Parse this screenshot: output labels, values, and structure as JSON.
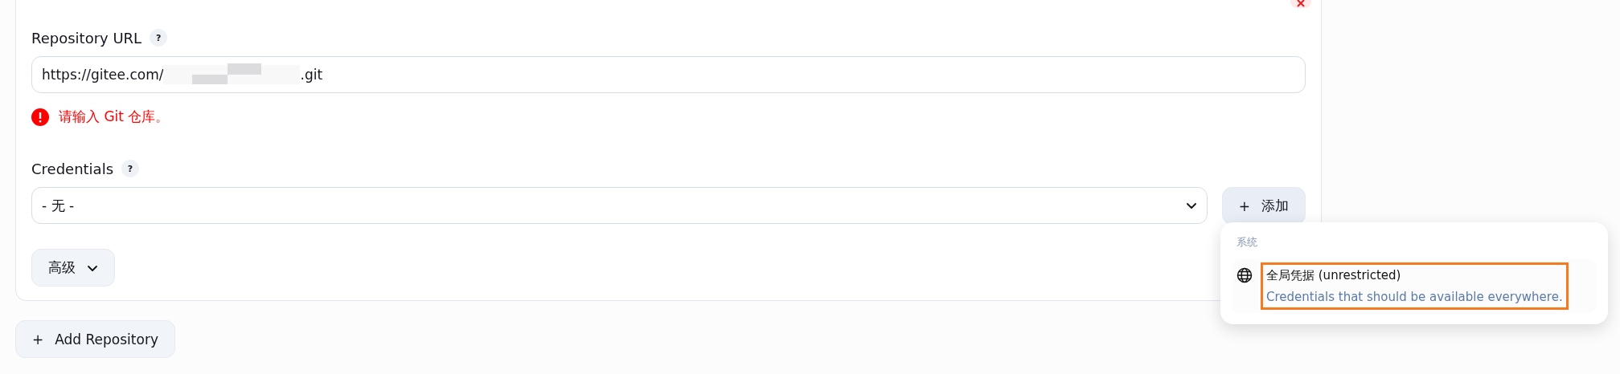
{
  "repository_url": {
    "label": "Repository URL",
    "help": "?",
    "value_start": "https://gitee.com/",
    "value_end": ".git",
    "redacted": true,
    "error": "请输入 Git 仓库。"
  },
  "credentials": {
    "label": "Credentials",
    "help": "?",
    "value": "- 无 -",
    "add_button": "添加",
    "add_icon": "+"
  },
  "advanced_button": "高级",
  "add_repository_button": "Add Repository",
  "add_repository_icon": "+",
  "popup": {
    "section": "系统",
    "items": [
      {
        "title": "全局凭据 (unrestricted)",
        "description": "Credentials that should be available everywhere.",
        "highlighted": true
      }
    ]
  }
}
